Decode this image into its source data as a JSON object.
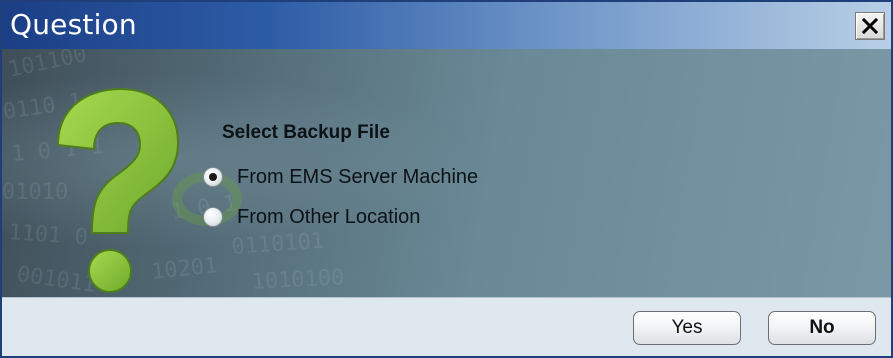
{
  "window": {
    "title": "Question"
  },
  "dialog": {
    "group_label": "Select Backup File",
    "options": [
      {
        "label": "From EMS Server Machine",
        "selected": true
      },
      {
        "label": "From Other Location",
        "selected": false
      }
    ],
    "icon": "question-mark-icon"
  },
  "buttons": {
    "yes_label": "Yes",
    "no_label": "No"
  },
  "colors": {
    "title_bar_start": "#1b3e86",
    "title_bar_end": "#b8cfe6",
    "content_dark": "#3f4e58",
    "content_light": "#7a98a5",
    "question_mark_green": "#8cc63f"
  }
}
